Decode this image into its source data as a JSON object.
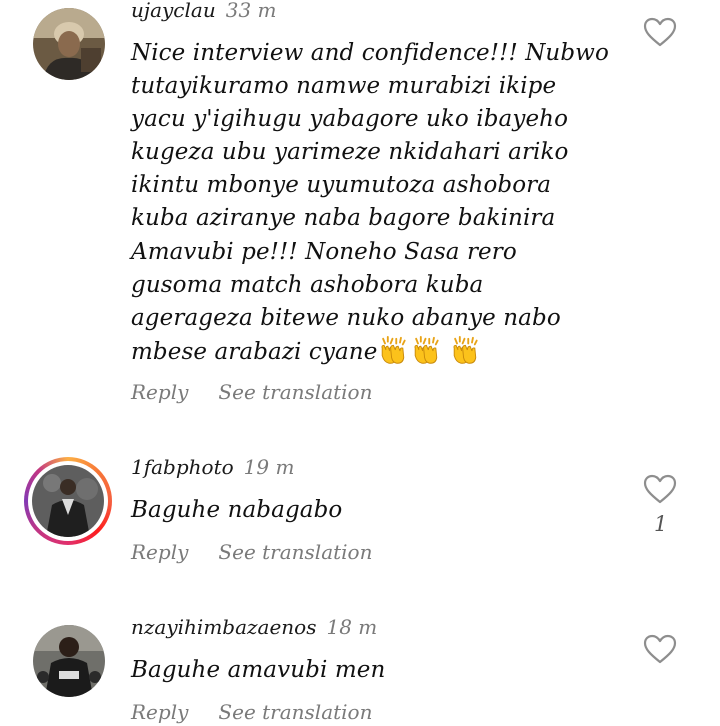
{
  "comments": [
    {
      "username": "ujayclau",
      "time": "33 m",
      "text": "Nice interview and confidence!!! Nubwo tutayikuramo namwe murabizi ikipe yacu y'igihugu yabagore uko ibayeho kugeza ubu yarimeze nkidahari ariko ikintu mbonye uyumutoza ashobora kuba aziranye naba bagore bakinira Amavubi pe!!! Noneho Sasa rero gusoma match ashobora kuba agerageza bitewe nuko abanye nabo mbese arabazi cyane",
      "emoji": [
        "clapping-hands",
        "clapping-hands",
        "clapping-hands"
      ],
      "reply_label": "Reply",
      "translate_label": "See translation",
      "likes": ""
    },
    {
      "username": "1fabphoto",
      "time": "19 m",
      "text": "Baguhe nabagabo",
      "reply_label": "Reply",
      "translate_label": "See translation",
      "likes": "1"
    },
    {
      "username": "nzayihimbazaenos",
      "time": "18 m",
      "text": "Baguhe amavubi men",
      "reply_label": "Reply",
      "translate_label": "See translation",
      "likes": ""
    }
  ],
  "colors": {
    "text": "#111111",
    "muted": "#7a7a7a",
    "story_ring": [
      "#fcaf45",
      "#e1306c",
      "#833ab4"
    ]
  }
}
